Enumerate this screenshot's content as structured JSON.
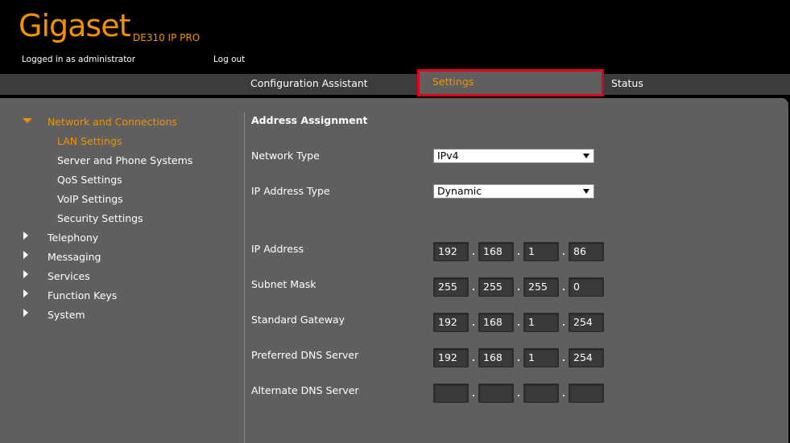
{
  "header": {
    "logo": "Gigaset",
    "product": "DE310 IP PRO",
    "logged_in": "Logged in as administrator",
    "logout": "Log out"
  },
  "nav": {
    "tabs": [
      {
        "label": "Configuration Assistant"
      },
      {
        "label": "Settings",
        "selected": true
      },
      {
        "label": "Status"
      }
    ]
  },
  "sidebar": {
    "items": [
      {
        "label": "Network and Connections",
        "expanded": true
      },
      {
        "label": "LAN Settings",
        "active": true
      },
      {
        "label": "Server and Phone Systems"
      },
      {
        "label": "QoS Settings"
      },
      {
        "label": "VoIP Settings"
      },
      {
        "label": "Security Settings"
      },
      {
        "label": "Telephony"
      },
      {
        "label": "Messaging"
      },
      {
        "label": "Services"
      },
      {
        "label": "Function Keys"
      },
      {
        "label": "System"
      }
    ]
  },
  "form": {
    "section_title": "Address Assignment",
    "network_type": {
      "label": "Network Type",
      "value": "IPv4"
    },
    "ip_address_type": {
      "label": "IP Address Type",
      "value": "Dynamic"
    },
    "ip_address": {
      "label": "IP Address",
      "octets": [
        "192",
        "168",
        "1",
        "86"
      ]
    },
    "subnet_mask": {
      "label": "Subnet Mask",
      "octets": [
        "255",
        "255",
        "255",
        "0"
      ]
    },
    "standard_gateway": {
      "label": "Standard Gateway",
      "octets": [
        "192",
        "168",
        "1",
        "254"
      ]
    },
    "preferred_dns": {
      "label": "Preferred DNS Server",
      "octets": [
        "192",
        "168",
        "1",
        "254"
      ]
    },
    "alternate_dns": {
      "label": "Alternate DNS Server",
      "octets": [
        "",
        "",
        "",
        ""
      ]
    }
  },
  "colors": {
    "accent": "#f29200",
    "highlight_box": "#e0001b",
    "panel": "#5f5f5f",
    "navbar": "#3c3c3c"
  }
}
